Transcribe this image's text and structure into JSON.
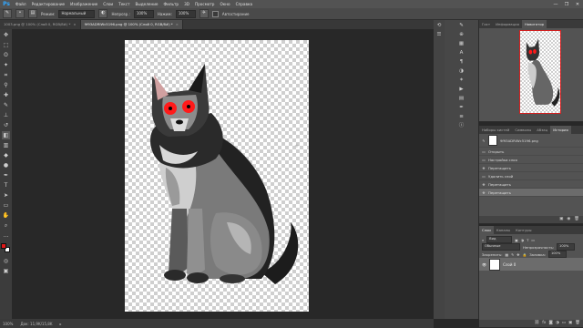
{
  "app": {
    "logo": "Ps"
  },
  "menu": [
    "Файл",
    "Редактирование",
    "Изображение",
    "Слои",
    "Текст",
    "Выделение",
    "Фильтр",
    "3D",
    "Просмотр",
    "Окно",
    "Справка"
  ],
  "window_controls": [
    "—",
    "❐",
    "✕"
  ],
  "options": {
    "feather_label": "Растушевка:",
    "feather_value": "0 пикс",
    "mode_label": "Режим:",
    "mode_value": "Нормальный",
    "opacity_label": "Непрозр.:",
    "opacity_value": "100%",
    "flow_label": "Нажим:",
    "flow_value": "100%",
    "airbrush_label": "Автостирание"
  },
  "tabs": [
    {
      "label": "1003.png @ 100% (Слой 0, RGB/8#) *",
      "active": false
    },
    {
      "label": "9f93ADRIWc5196.png @ 100% (Слой 0, RGB/8#) *",
      "active": true
    }
  ],
  "status": {
    "zoom": "100%",
    "doc": "Док: 11,9K/15,8K",
    "arrow": "▸"
  },
  "navigator": {
    "tabs": [
      "Гист",
      "Информация",
      "Навигатор"
    ],
    "active_tab": 2,
    "zoom": "100%"
  },
  "history": {
    "tabs": [
      "Наборы кистей",
      "Символы",
      "Абзац",
      "История"
    ],
    "active_tab": 3,
    "snapshot": "9f93ADRIWc5196.png",
    "steps": [
      "Открыть",
      "Настройки слоя",
      "Перетащить",
      "Удалить слой",
      "Перетащить",
      "Перетащить"
    ],
    "selected_index": 5
  },
  "layers": {
    "tabs": [
      "Слои",
      "Каналы",
      "Контуры"
    ],
    "active_tab": 0,
    "filter_label": "Вид",
    "blend_mode": "Обычные",
    "opacity_label": "Непрозрачность:",
    "opacity_value": "100%",
    "lock_label": "Закрепить:",
    "fill_label": "Заливка:",
    "fill_value": "100%",
    "layer_name": "Слой 0"
  },
  "colors": {
    "foreground": "#e01818",
    "background": "#ffffff",
    "eye_glow": "#ff1a1a"
  }
}
